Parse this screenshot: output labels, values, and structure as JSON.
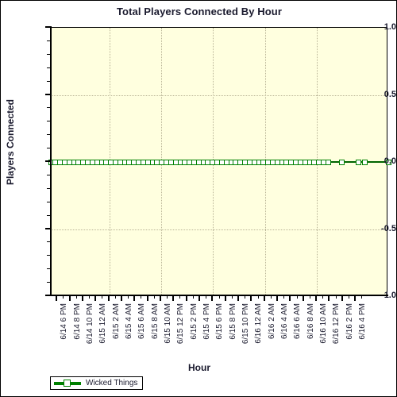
{
  "chart_data": {
    "type": "line",
    "title": "Total Players Connected By Hour",
    "xlabel": "Hour",
    "ylabel": "Players Connected",
    "ylim": [
      -1.0,
      1.0
    ],
    "y_ticks": [
      1.0,
      0.5,
      0.0,
      -0.5,
      -1.0
    ],
    "y_tick_labels": [
      "1.0",
      "0.5",
      "0.0",
      "-0.5",
      "-1.0"
    ],
    "y_minor_tick_step": 0.1,
    "grid": true,
    "grid_style": "dotted",
    "legend_position": "bottom-left",
    "categories": [
      "6/14 6 PM",
      "6/14 8 PM",
      "6/14 10 PM",
      "6/15 12 AM",
      "6/15 2 AM",
      "6/15 4 AM",
      "6/15 6 AM",
      "6/15 8 AM",
      "6/15 10 AM",
      "6/15 12 PM",
      "6/15 2 PM",
      "6/15 4 PM",
      "6/15 6 PM",
      "6/15 8 PM",
      "6/15 10 PM",
      "6/16 12 AM",
      "6/16 2 AM",
      "6/16 4 AM",
      "6/16 6 AM",
      "6/16 8 AM",
      "6/16 10 AM",
      "6/16 12 PM",
      "6/16 2 PM",
      "6/16 4 PM"
    ],
    "series": [
      {
        "name": "Wicked Things",
        "color": "#008000",
        "marker": "open-square",
        "values": [
          0,
          0,
          0,
          0,
          0,
          0,
          0,
          0,
          0,
          0,
          0,
          0,
          0,
          0,
          0,
          0,
          0,
          0,
          0,
          0,
          0,
          0,
          0,
          0,
          0,
          0,
          0,
          0,
          0,
          0,
          0,
          0,
          0,
          0,
          0,
          0,
          0,
          0,
          0,
          0,
          0,
          0,
          0,
          0,
          0,
          0,
          0,
          0
        ]
      }
    ],
    "marker_x_fractions": [
      0.0,
      0.0137,
      0.0274,
      0.0411,
      0.0548,
      0.0685,
      0.0822,
      0.0959,
      0.1096,
      0.1233,
      0.137,
      0.1507,
      0.1644,
      0.1781,
      0.1918,
      0.2055,
      0.2192,
      0.2329,
      0.2466,
      0.2603,
      0.274,
      0.2877,
      0.3014,
      0.3151,
      0.3288,
      0.3425,
      0.3562,
      0.3699,
      0.3836,
      0.3973,
      0.411,
      0.4247,
      0.4384,
      0.4521,
      0.4658,
      0.4795,
      0.4932,
      0.5069,
      0.5206,
      0.5343,
      0.548,
      0.5617,
      0.5754,
      0.5891,
      0.6028,
      0.6165,
      0.6302,
      0.6439,
      0.6576,
      0.6713,
      0.685,
      0.6987,
      0.7124,
      0.7261,
      0.7398,
      0.7535,
      0.7672,
      0.7809,
      0.7946,
      0.8083,
      0.822,
      0.863,
      0.911,
      0.9315,
      1.0
    ]
  },
  "legend": {
    "entries": [
      {
        "label": "Wicked Things",
        "color": "#008000"
      }
    ]
  },
  "colors": {
    "plot_background": "#ffffdf",
    "page_background": "#ffffff",
    "border": "#000000",
    "text": "#1a1a2e",
    "grid": "#b9b497",
    "series_green": "#008000",
    "series_line_dark": "#006400"
  }
}
